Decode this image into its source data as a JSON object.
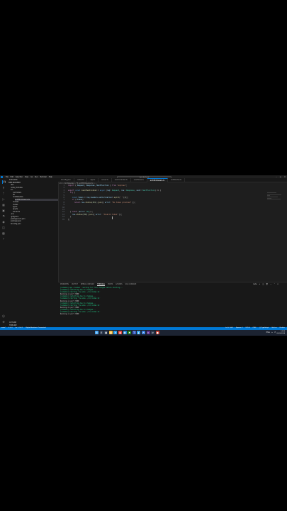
{
  "window": {
    "menu": [
      "File",
      "Edit",
      "Selection",
      "View",
      "Go",
      "Run",
      "Terminal",
      "Help"
    ],
    "command_center": "npm-backend"
  },
  "sidebar": {
    "header": "EXPLORER",
    "items": [
      {
        "label": "NPM-BACKEND",
        "indent": 0
      },
      {
        "label": "dist",
        "indent": 1
      },
      {
        "label": "node_modules",
        "indent": 1
      },
      {
        "label": "src",
        "indent": 1
      },
      {
        "label": "controllers",
        "indent": 2
      },
      {
        "label": "db",
        "indent": 2
      },
      {
        "label": "middlewares",
        "indent": 2
      },
      {
        "label": "authMiddleware.ts",
        "indent": 3,
        "selected": true
      },
      {
        "label": "models",
        "indent": 2
      },
      {
        "label": "routes",
        "indent": 2
      },
      {
        "label": "types",
        "indent": 2
      },
      {
        "label": "app.ts",
        "indent": 2
      },
      {
        "label": "server.ts",
        "indent": 2
      },
      {
        "label": ".env",
        "indent": 1
      },
      {
        "label": ".gitignore",
        "indent": 1
      },
      {
        "label": "package-lock.json",
        "indent": 1
      },
      {
        "label": "package.json",
        "indent": 1
      },
      {
        "label": "tsconfig.json",
        "indent": 1
      }
    ],
    "outline": "OUTLINE",
    "timeline": "TIMELINE"
  },
  "tabs": [
    {
      "label": "tsconfig.json"
    },
    {
      "label": "routes.ts"
    },
    {
      "label": "app.ts"
    },
    {
      "label": "server.ts"
    },
    {
      "label": "userController.ts"
    },
    {
      "label": "userModel.ts"
    },
    {
      "label": "authMiddleware.ts",
      "active": true
    },
    {
      "label": "authRoutes.ts"
    }
  ],
  "breadcrumb": "src > middlewares > TS authMiddleware.ts > ...",
  "code_lines": [
    {
      "n": "1",
      "html": "<span class='kw'>import</span> <span class='pun'>{ </span><span class='var'>Request</span><span class='pun'>, </span><span class='var'>Response</span><span class='pun'>, </span><span class='var'>NextFunction</span><span class='pun'> } </span><span class='kw'>from</span> <span class='str'>\"express\"</span><span class='pun'>;</span>"
    },
    {
      "n": "2",
      "html": ""
    },
    {
      "n": "3",
      "html": "<span class='kw'>export</span> <span class='kw2'>const</span> <span class='fn'>isAuthenticated</span> <span class='pun'>= </span><span class='kw2'>async</span> <span class='pun'>(</span><span class='var'>req</span><span class='pun'>: </span><span class='ty'>Request</span><span class='pun'>, </span><span class='var'>res</span><span class='pun'>: </span><span class='ty'>Response</span><span class='pun'>, </span><span class='var'>next</span><span class='pun'>: </span><span class='ty'>NextFunction</span><span class='pun'>) =&gt; {</span>"
    },
    {
      "n": "4",
      "html": "  <span class='kw'>try</span> <span class='pun'>{</span>"
    },
    {
      "n": "5",
      "html": ""
    },
    {
      "n": "6",
      "html": "    <span class='kw2'>const</span> <span class='var'>token</span> <span class='pun'>= </span><span class='var'>req</span><span class='pun'>.</span><span class='var'>headers</span><span class='pun'>.</span><span class='var'>authorization</span><span class='pun'>?.</span><span class='fn'>split</span><span class='pun'>(</span><span class='str'>\" \"</span><span class='pun'>)[</span><span class='num'>1</span><span class='pun'>];</span>"
    },
    {
      "n": "7",
      "html": "    <span class='kw'>if</span> <span class='pun'>(!</span><span class='var'>token</span><span class='pun'>)</span>"
    },
    {
      "n": "8",
      "html": "      <span class='kw'>return</span> <span class='var'>res</span><span class='pun'>.</span><span class='fn'>status</span><span class='pun'>(</span><span class='num'>401</span><span class='pun'>).</span><span class='fn'>json</span><span class='pun'>({ </span><span class='var'>error</span><span class='pun'>: </span><span class='str'>\"No token provided\"</span><span class='pun'> });</span>"
    },
    {
      "n": "9",
      "html": ""
    },
    {
      "n": "10",
      "html": ""
    },
    {
      "n": "11",
      "html": ""
    },
    {
      "n": "12",
      "html": "  <span class='pun'>} </span><span class='kw'>catch</span> <span class='pun'>(</span><span class='var'>error</span><span class='pun'>: </span><span class='ty'>any</span><span class='pun'>) {</span>"
    },
    {
      "n": "13",
      "html": "    <span class='var'>res</span><span class='pun'>.</span><span class='fn'>status</span><span class='pun'>(</span><span class='num'>500</span><span class='pun'>).</span><span class='fn'>json</span><span class='pun'>({ </span><span class='var'>error</span><span class='pun'>: </span><span class='str'>\"Invalid token\"</span><span class='pun'> });</span>"
    },
    {
      "n": "14",
      "html": "  <span class='pun'>}</span>"
    },
    {
      "n": "15",
      "html": "<span class='pun'>};</span>"
    }
  ],
  "panel": {
    "tabs": [
      "PROBLEMS",
      "OUTPUT",
      "DEBUG CONSOLE",
      "TERMINAL",
      "PORTS",
      "GITLENS",
      "SQL CONSOLE"
    ],
    "active_tab": "TERMINAL",
    "shell": "node",
    "terminal_lines": [
      {
        "t": "[nodemon] app crashed - waiting for file changes before starting...",
        "c": "g"
      },
      {
        "t": "[nodemon] restarting due to changes...",
        "c": "g"
      },
      {
        "t": "[nodemon] starting `ts-node ./src/index.ts`",
        "c": "g"
      },
      {
        "t": "Running on port 3000",
        "c": "w"
      },
      {
        "t": "[nodemon] restarting due to changes...",
        "c": "g"
      },
      {
        "t": "[nodemon] starting `ts-node ./src/index.ts`",
        "c": "g"
      },
      {
        "t": "Running on port 3000",
        "c": "w"
      },
      {
        "t": "[nodemon] restarting due to changes...",
        "c": "g"
      },
      {
        "t": "[nodemon] starting `ts-node ./src/index.ts`",
        "c": "g"
      },
      {
        "t": "Running on port 3000",
        "c": "w"
      },
      {
        "t": "[nodemon] restarting due to changes...",
        "c": "g"
      },
      {
        "t": "[nodemon] starting `ts-node ./src/index.ts`",
        "c": "g"
      },
      {
        "t": "Running on port 3000",
        "c": "w"
      }
    ]
  },
  "statusbar": {
    "left": [
      "main*",
      "0 ⚠ 0",
      "Ln 1, Col 1",
      "Digital Assistant: Connected"
    ],
    "right": [
      "Ln 9, Col 5",
      "Spaces: 2",
      "UTF-8",
      "CRLF",
      "{} TypeScript",
      "Go Live",
      "Prettier"
    ]
  },
  "taskbar": {
    "time": "14:26",
    "date": "02-05-2024",
    "lang": "ENG"
  },
  "colors": {
    "accent": "#0078d4",
    "editor_bg": "#1e1e1e",
    "sidebar_bg": "#181818"
  }
}
